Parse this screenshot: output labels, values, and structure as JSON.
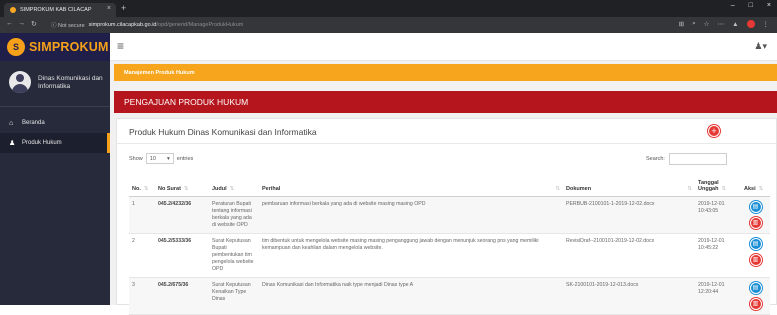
{
  "browser": {
    "tab_title": "SIMPROKUM KAB CILACAP",
    "tab_close": "×",
    "new_tab": "+",
    "window_controls": [
      "–",
      "□",
      "×"
    ],
    "security": "ⓘ Not secure",
    "url_host": "simprokum.cilacapkab.go.id",
    "url_path": "/opd/generid/ManageProdukHukum"
  },
  "app": {
    "brand": "SIMPROKUM",
    "badge_letter": "S",
    "accent_color": "#f7a11a",
    "sidebar_color": "#262a3b"
  },
  "sidebar": {
    "profile_name": "Dinas Komunikasi dan Informatika",
    "items": [
      {
        "label": "Beranda",
        "icon": "home-icon",
        "glyph": "⌂"
      },
      {
        "label": "Produk Hukum",
        "icon": "user-icon",
        "glyph": "♟"
      }
    ]
  },
  "main": {
    "breadcrumb": "Manajemen Produk Hukum",
    "section_title": "PENGAJUAN PRODUK HUKUM",
    "panel_title": "Produk Hukum Dinas Komunikasi dan Informatika",
    "add_glyph": "+",
    "show_label": "Show",
    "show_value": "10",
    "entries_label": "entries",
    "search_label": "Search:"
  },
  "table": {
    "columns": [
      "No.",
      "No Surat",
      "Judul",
      "Perihal",
      "Dokumen",
      "Tanggal Unggah",
      "Aksi"
    ],
    "rows": [
      {
        "no": "1",
        "no_surat": "045.2/4232/36",
        "judul": "Peraturan Bupati tentang informasi berkala yang ada di website OPD",
        "perihal": "pembaruan informasi berkala yang ada di website masing masing OPD",
        "dokumen": "PERBUB-2100101-1-2019-12-02.docx",
        "tanggal": "2019-12-01 10:43:05"
      },
      {
        "no": "2",
        "no_surat": "045.2/5333/36",
        "judul": "Surat Keputusan Bupati pembentukan tim pengelola website OPD",
        "perihal": "tim dibentuk untuk mengelola website masing masing penganggung jawab dengan menunjuk seorang pns yang memiliki kemampuan dan keahlian dalam mengelola website.",
        "dokumen": "RevisiDraf--2100101-2019-12-02.docx",
        "tanggal": "2019-12-01 10:45:22"
      },
      {
        "no": "3",
        "no_surat": "045.2/675/36",
        "judul": "Surat Keputusan Kenaikan Type Dinas",
        "perihal": "Dinas Komunikasi dan Informatika naik type menjadi Dinas type A",
        "dokumen": "SK-2100101-2019-12-013.docx",
        "tanggal": "2019-12-01 12:20:44"
      }
    ]
  }
}
